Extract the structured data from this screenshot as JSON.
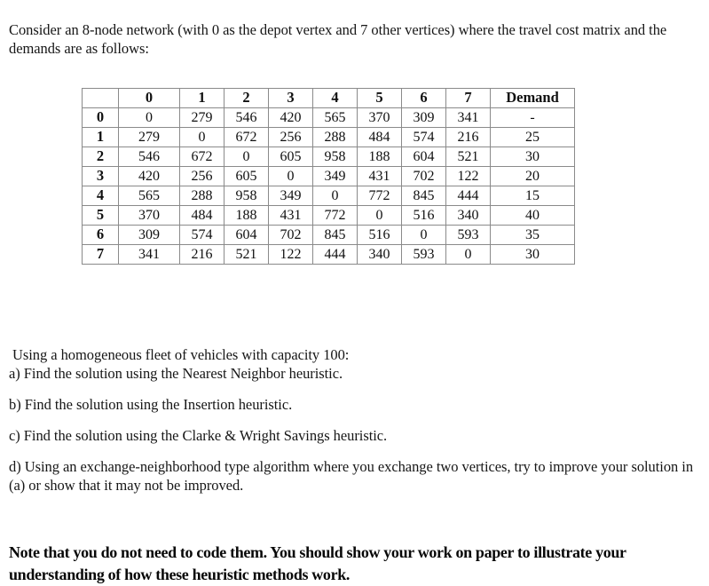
{
  "intro": {
    "paragraph": "Consider an 8-node network (with 0 as the depot vertex and 7 other vertices) where the travel cost matrix and the demands are as follows:"
  },
  "matrix": {
    "corner_label": "",
    "column_headers": [
      "0",
      "1",
      "2",
      "3",
      "4",
      "5",
      "6",
      "7"
    ],
    "demand_header": "Demand",
    "row_headers": [
      "0",
      "1",
      "2",
      "3",
      "4",
      "5",
      "6",
      "7"
    ],
    "rows": [
      {
        "label": "0",
        "costs": [
          "0",
          "279",
          "546",
          "420",
          "565",
          "370",
          "309",
          "341"
        ],
        "demand": "-"
      },
      {
        "label": "1",
        "costs": [
          "279",
          "0",
          "672",
          "256",
          "288",
          "484",
          "574",
          "216"
        ],
        "demand": "25"
      },
      {
        "label": "2",
        "costs": [
          "546",
          "672",
          "0",
          "605",
          "958",
          "188",
          "604",
          "521"
        ],
        "demand": "30"
      },
      {
        "label": "3",
        "costs": [
          "420",
          "256",
          "605",
          "0",
          "349",
          "431",
          "702",
          "122"
        ],
        "demand": "20"
      },
      {
        "label": "4",
        "costs": [
          "565",
          "288",
          "958",
          "349",
          "0",
          "772",
          "845",
          "444"
        ],
        "demand": "15"
      },
      {
        "label": "5",
        "costs": [
          "370",
          "484",
          "188",
          "431",
          "772",
          "0",
          "516",
          "340"
        ],
        "demand": "40"
      },
      {
        "label": "6",
        "costs": [
          "309",
          "574",
          "604",
          "702",
          "845",
          "516",
          "0",
          "593"
        ],
        "demand": "35"
      },
      {
        "label": "7",
        "costs": [
          "341",
          "216",
          "521",
          "122",
          "444",
          "340",
          "593",
          "0"
        ],
        "demand": "30"
      }
    ]
  },
  "questions": {
    "intro": " Using a homogeneous fleet of vehicles with capacity 100:",
    "a": "a) Find the solution using the Nearest Neighbor heuristic.",
    "b": "b) Find the solution using the Insertion heuristic.",
    "c": "c) Find the solution using the Clarke & Wright Savings heuristic.",
    "d": "d) Using an exchange-neighborhood type algorithm where you exchange two vertices, try to improve your solution in (a) or show that it may not be improved."
  },
  "note": {
    "text": "Note that you do not need to code them. You should show your work on paper to illustrate your understanding of how these heuristic methods work."
  }
}
